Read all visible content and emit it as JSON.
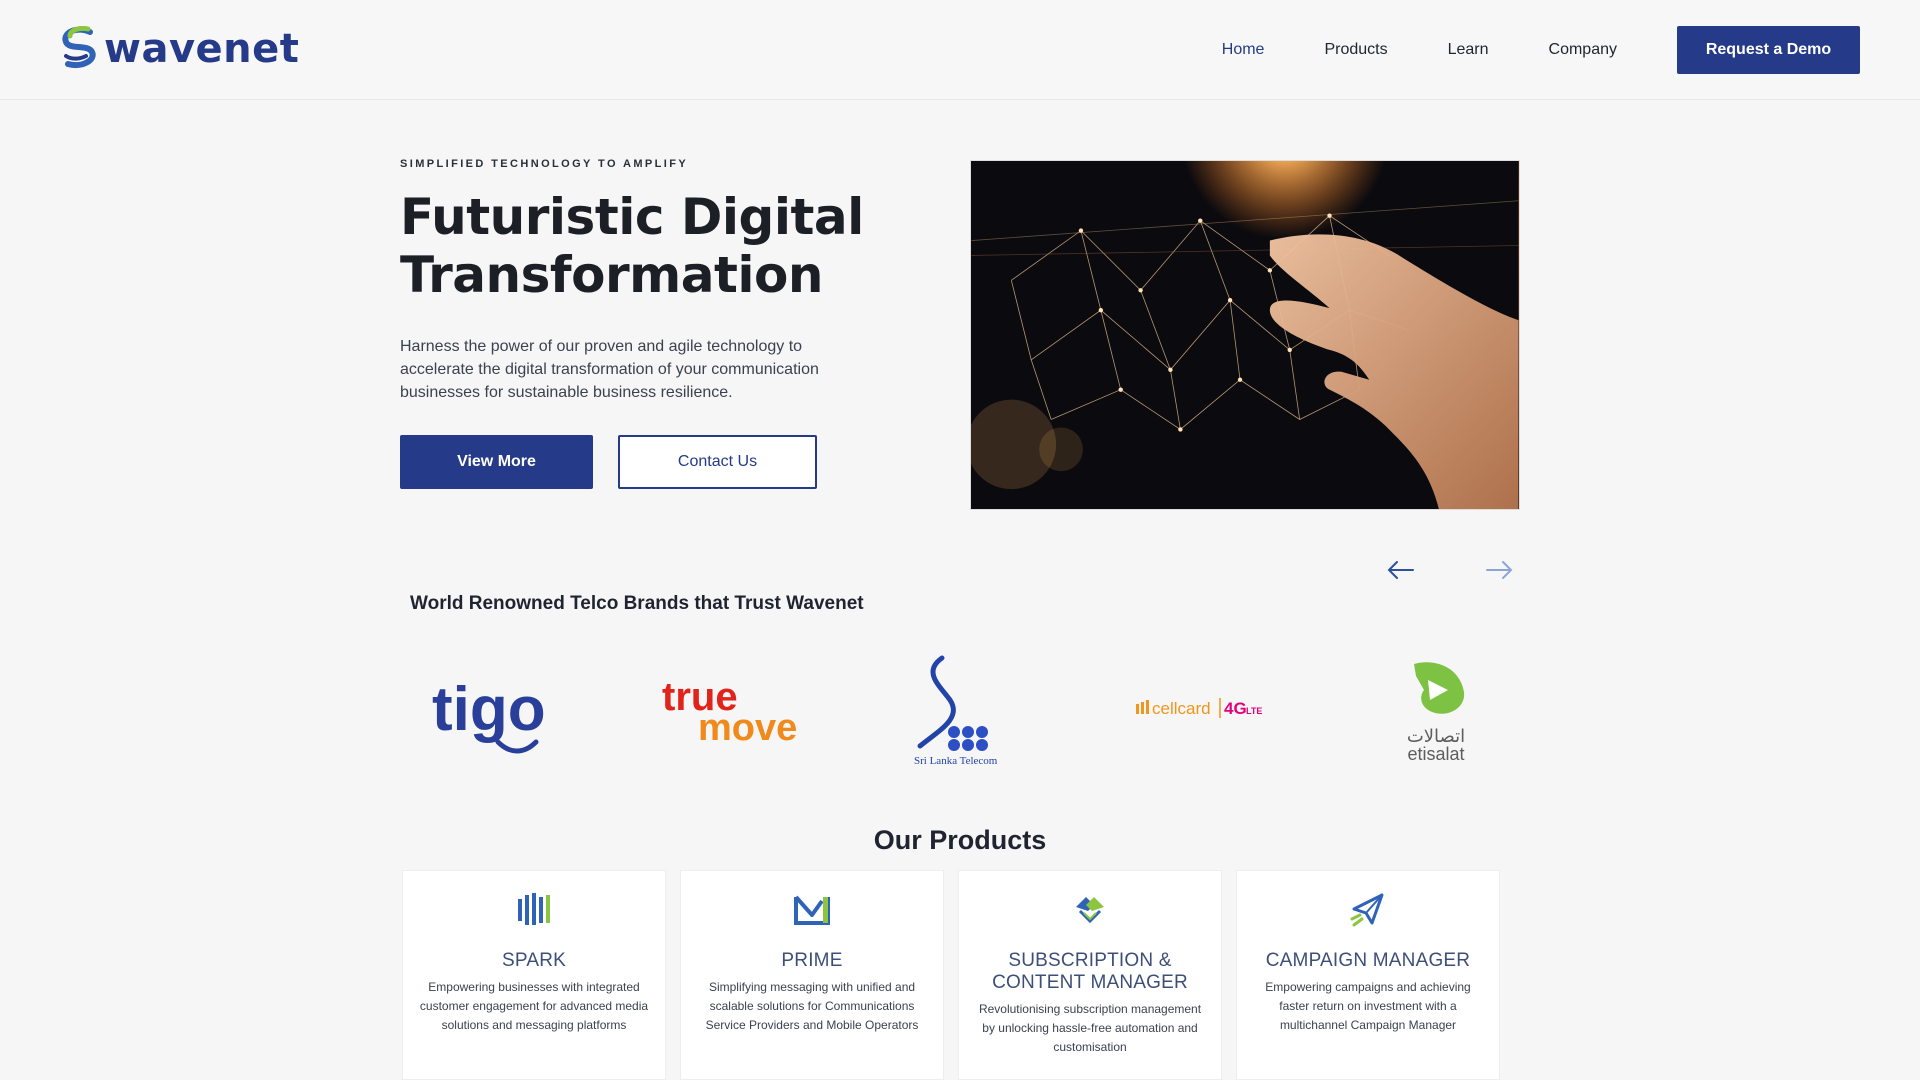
{
  "brand": {
    "name": "wavenet",
    "colors": {
      "navy": "#253a88",
      "green": "#8cc63f",
      "blue": "#2e63b8"
    }
  },
  "nav": {
    "items": [
      {
        "label": "Home",
        "active": true
      },
      {
        "label": "Products",
        "active": false
      },
      {
        "label": "Learn",
        "active": false
      },
      {
        "label": "Company",
        "active": false
      }
    ],
    "cta": "Request a Demo"
  },
  "hero": {
    "eyebrow": "SIMPLIFIED TECHNOLOGY TO AMPLIFY",
    "title": "Futuristic Digital Transformation",
    "description": "Harness the power of our proven and agile technology to accelerate the digital transformation of your communication businesses for sustainable business resilience.",
    "primary_button": "View More",
    "secondary_button": "Contact Us",
    "image": "digital-network-hand-photo",
    "carousel": {
      "prev_icon": "arrow-left-icon",
      "next_icon": "arrow-right-icon"
    }
  },
  "brands": {
    "title": "World Renowned Telco Brands that Trust Wavenet",
    "logos": [
      {
        "name": "tigo",
        "text": "tigo"
      },
      {
        "name": "truemove",
        "text_top": "true",
        "text_bottom": "move"
      },
      {
        "name": "sri-lanka-telecom",
        "text": "Sri Lanka Telecom"
      },
      {
        "name": "cellcard",
        "text": "cellcard",
        "badge": "4G",
        "badge_sub": "LTE"
      },
      {
        "name": "etisalat",
        "text": "etisalat",
        "text_arabic": "اتصالات"
      }
    ]
  },
  "products": {
    "title": "Our Products",
    "cards": [
      {
        "icon": "bars-icon",
        "name": "SPARK",
        "desc": "Empowering businesses with integrated customer engagement for advanced media solutions and messaging platforms"
      },
      {
        "icon": "envelope-m-icon",
        "name": "PRIME",
        "desc": "Simplifying messaging with unified and scalable solutions for Communications Service Providers and Mobile Operators"
      },
      {
        "icon": "handshake-icon",
        "name": "SUBSCRIPTION & CONTENT MANAGER",
        "desc": "Revolutionising subscription management by unlocking hassle-free automation and customisation"
      },
      {
        "icon": "paper-plane-icon",
        "name": "CAMPAIGN MANAGER",
        "desc": "Empowering campaigns and achieving faster return on investment with a multichannel Campaign Manager"
      }
    ]
  }
}
